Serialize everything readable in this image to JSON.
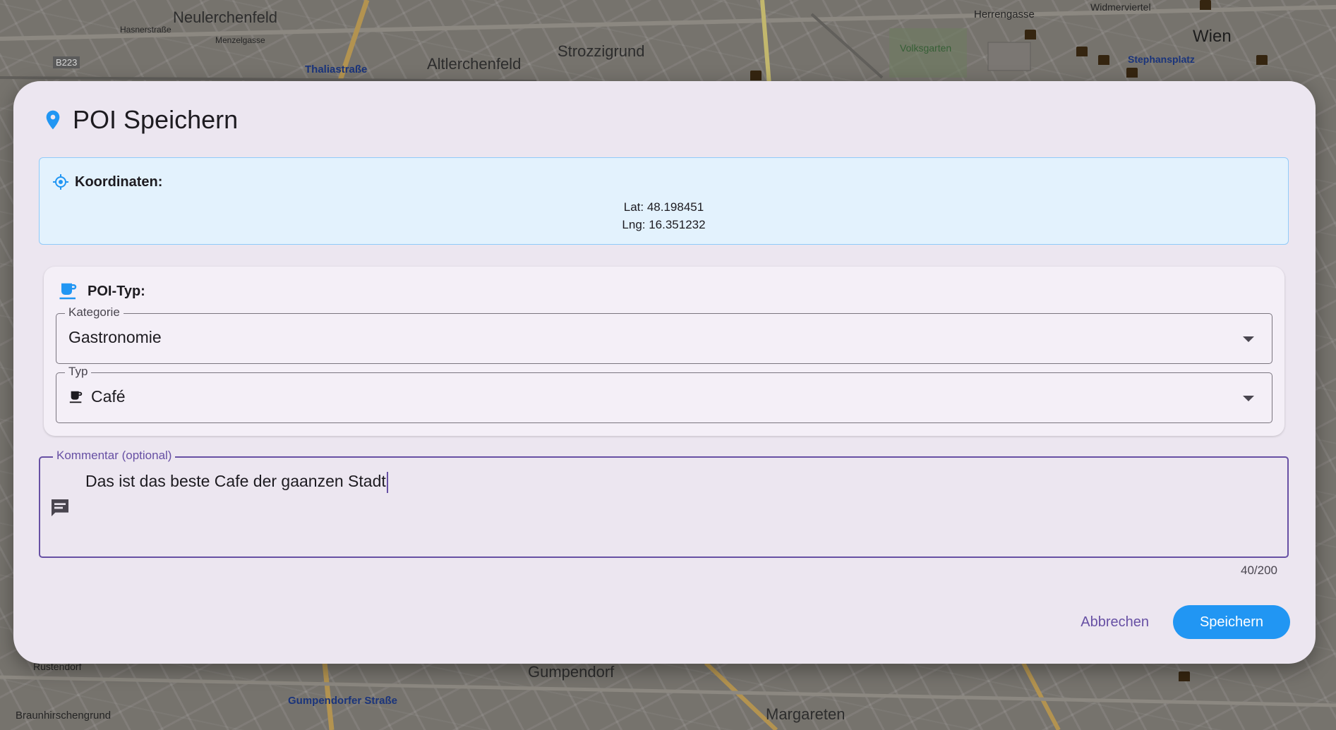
{
  "map": {
    "labels": [
      "Neulerchenfeld",
      "Altlerchenfeld",
      "Strozzigrund",
      "Wien",
      "Herrengasse",
      "Widmerviertel",
      "Stephansplatz",
      "Volksgarten",
      "Thaliastraße",
      "B223",
      "Hasnerstraße",
      "Menzelgasse",
      "Gumpendorf",
      "Margareten",
      "Gumpendorfer Straße",
      "Braunhirschengrund",
      "Rustendorf"
    ]
  },
  "dialog": {
    "title": "POI Speichern",
    "icon": "location-pin-icon",
    "coordinates": {
      "label": "Koordinaten:",
      "lat": "Lat: 48.198451",
      "lng": "Lng: 16.351232"
    },
    "poi_type": {
      "label": "POI-Typ:",
      "category_label": "Kategorie",
      "category_value": "Gastronomie",
      "type_label": "Typ",
      "type_value": "Café"
    },
    "comment": {
      "label": "Kommentar (optional)",
      "value": "Das ist das beste Cafe der gaanzen Stadt",
      "counter": "40/200"
    },
    "actions": {
      "cancel": "Abbrechen",
      "save": "Speichern"
    }
  },
  "colors": {
    "accent": "#2196f3",
    "primary": "#6750a4",
    "dialog_bg": "#ece6f0",
    "coord_bg": "#e3f2fd"
  }
}
